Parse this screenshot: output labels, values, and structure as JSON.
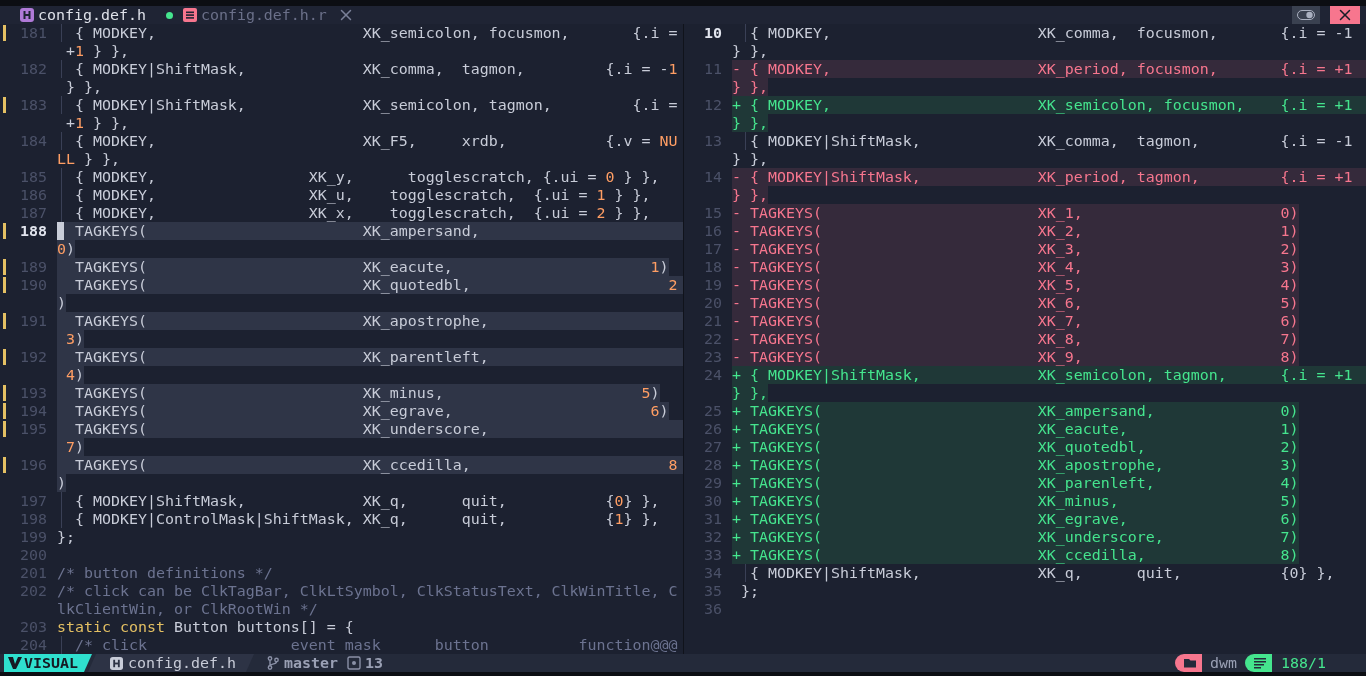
{
  "tabs": [
    {
      "label": "config.def.h",
      "selected": true,
      "modified": true,
      "closable": false
    },
    {
      "label": "config.def.h.r",
      "selected": false,
      "modified": false,
      "closable": true
    }
  ],
  "panes": [
    {
      "kind": "source",
      "lines": [
        {
          "number": "181",
          "changed": true,
          "guide": true,
          "selected": false,
          "current": false,
          "rows": [
            {
              "text": "  { MODKEY,                       XK_semicolon, focusmon,       {.i ="
            },
            {
              "parts": [
                " +",
                {
                  "kind": "number",
                  "text": "1"
                },
                " } },"
              ]
            }
          ]
        },
        {
          "number": "182",
          "changed": false,
          "guide": true,
          "selected": false,
          "current": false,
          "rows": [
            {
              "parts": [
                "  { MODKEY|ShiftMask,             XK_comma,  tagmon,         {.i = -",
                {
                  "kind": "number",
                  "text": "1"
                }
              ]
            },
            {
              "text": " } },"
            }
          ]
        },
        {
          "number": "183",
          "changed": true,
          "guide": true,
          "selected": false,
          "current": false,
          "rows": [
            {
              "text": "  { MODKEY|ShiftMask,             XK_semicolon, tagmon,         {.i ="
            },
            {
              "parts": [
                " +",
                {
                  "kind": "number",
                  "text": "1"
                },
                " } },"
              ]
            }
          ]
        },
        {
          "number": "184",
          "changed": false,
          "guide": true,
          "selected": false,
          "current": false,
          "rows": [
            {
              "parts": [
                "  { MODKEY,                       XK_F5,     xrdb,           {.v = ",
                {
                  "kind": "number",
                  "text": "NU"
                }
              ]
            },
            {
              "parts": [
                {
                  "kind": "number",
                  "text": "LL"
                },
                " } },"
              ]
            }
          ]
        },
        {
          "number": "185",
          "changed": false,
          "guide": true,
          "selected": false,
          "current": false,
          "rows": [
            {
              "parts": [
                "  { MODKEY,                 XK_y,      togglescratch, {.ui = ",
                {
                  "kind": "number",
                  "text": "0"
                },
                " } },"
              ]
            }
          ]
        },
        {
          "number": "186",
          "changed": false,
          "guide": true,
          "selected": false,
          "current": false,
          "rows": [
            {
              "parts": [
                "  { MODKEY,                 XK_u,    togglescratch,  {.ui = ",
                {
                  "kind": "number",
                  "text": "1"
                },
                " } },"
              ]
            }
          ]
        },
        {
          "number": "187",
          "changed": false,
          "guide": true,
          "selected": false,
          "current": false,
          "rows": [
            {
              "parts": [
                "  { MODKEY,                 XK_x,    togglescratch,  {.ui = ",
                {
                  "kind": "number",
                  "text": "2"
                },
                " } },"
              ]
            }
          ]
        },
        {
          "number": "188",
          "changed": true,
          "guide": false,
          "selected": true,
          "current": true,
          "rows": [
            {
              "text": "  TAGKEYS(                        XK_ampersand,"
            },
            {
              "parts": [
                {
                  "kind": "number",
                  "text": "0"
                },
                ")"
              ]
            }
          ]
        },
        {
          "number": "189",
          "changed": true,
          "guide": false,
          "selected": true,
          "current": false,
          "rows": [
            {
              "parts": [
                "  TAGKEYS(                        XK_eacute,                      ",
                {
                  "kind": "number",
                  "text": "1"
                },
                ")"
              ]
            }
          ]
        },
        {
          "number": "190",
          "changed": true,
          "guide": false,
          "selected": true,
          "current": false,
          "rows": [
            {
              "parts": [
                "  TAGKEYS(                        XK_quotedbl,                      ",
                {
                  "kind": "number",
                  "text": "2"
                }
              ]
            },
            {
              "text": ")"
            }
          ]
        },
        {
          "number": "191",
          "changed": true,
          "guide": false,
          "selected": true,
          "current": false,
          "rows": [
            {
              "text": "  TAGKEYS(                        XK_apostrophe,"
            },
            {
              "parts": [
                {
                  "kind": "number",
                  "text": " 3"
                },
                ")"
              ]
            }
          ]
        },
        {
          "number": "192",
          "changed": true,
          "guide": false,
          "selected": true,
          "current": false,
          "rows": [
            {
              "text": "  TAGKEYS(                        XK_parentleft,"
            },
            {
              "parts": [
                {
                  "kind": "number",
                  "text": " 4"
                },
                ")"
              ]
            }
          ]
        },
        {
          "number": "193",
          "changed": true,
          "guide": false,
          "selected": true,
          "current": false,
          "rows": [
            {
              "parts": [
                "  TAGKEYS(                        XK_minus,                      ",
                {
                  "kind": "number",
                  "text": "5"
                },
                ")"
              ]
            }
          ]
        },
        {
          "number": "194",
          "changed": true,
          "guide": false,
          "selected": true,
          "current": false,
          "rows": [
            {
              "parts": [
                "  TAGKEYS(                        XK_egrave,                      ",
                {
                  "kind": "number",
                  "text": "6"
                },
                ")"
              ]
            }
          ]
        },
        {
          "number": "195",
          "changed": true,
          "guide": false,
          "selected": true,
          "current": false,
          "rows": [
            {
              "text": "  TAGKEYS(                        XK_underscore,"
            },
            {
              "parts": [
                {
                  "kind": "number",
                  "text": " 7"
                },
                ")"
              ]
            }
          ]
        },
        {
          "number": "196",
          "changed": true,
          "guide": false,
          "selected": true,
          "current": false,
          "rows": [
            {
              "parts": [
                "  TAGKEYS(                        XK_ccedilla,                      ",
                {
                  "kind": "number",
                  "text": "8"
                }
              ]
            },
            {
              "text": ")"
            }
          ]
        },
        {
          "number": "197",
          "changed": false,
          "guide": true,
          "selected": false,
          "current": false,
          "rows": [
            {
              "parts": [
                "  { MODKEY|ShiftMask,             XK_q,      quit,           {",
                {
                  "kind": "number",
                  "text": "0"
                },
                "} },"
              ]
            }
          ]
        },
        {
          "number": "198",
          "changed": false,
          "guide": true,
          "selected": false,
          "current": false,
          "rows": [
            {
              "parts": [
                "  { MODKEY|ControlMask|ShiftMask, XK_q,      quit,           {",
                {
                  "kind": "number",
                  "text": "1"
                },
                "} },"
              ]
            }
          ]
        },
        {
          "number": "199",
          "changed": false,
          "guide": false,
          "selected": false,
          "current": false,
          "rows": [
            {
              "text": "};"
            }
          ]
        },
        {
          "number": "200",
          "changed": false,
          "guide": false,
          "selected": false,
          "current": false
        },
        {
          "number": "201",
          "changed": false,
          "guide": false,
          "selected": false,
          "current": false,
          "rows": [
            {
              "parts": [
                {
                  "kind": "comment",
                  "text": "/* button definitions */"
                }
              ]
            }
          ]
        },
        {
          "number": "202",
          "changed": false,
          "guide": false,
          "selected": false,
          "current": false,
          "rows": [
            {
              "parts": [
                {
                  "kind": "comment",
                  "text": "/* click can be ClkTagBar, ClkLtSymbol, ClkStatusText, ClkWinTitle, C"
                }
              ]
            },
            {
              "parts": [
                {
                  "kind": "comment",
                  "text": "lkClientWin, or ClkRootWin */"
                }
              ]
            }
          ]
        },
        {
          "number": "203",
          "changed": false,
          "guide": false,
          "selected": false,
          "current": false,
          "rows": [
            {
              "parts": [
                {
                  "kind": "keyword",
                  "text": "static const"
                },
                " Button buttons[] = {"
              ]
            }
          ]
        },
        {
          "number": "204",
          "changed": false,
          "guide": true,
          "selected": false,
          "current": false,
          "rows": [
            {
              "parts": [
                {
                  "kind": "comment",
                  "text": "  /* click                event mask      button          function@@@"
                }
              ]
            }
          ]
        }
      ]
    },
    {
      "kind": "diff",
      "lines": [
        {
          "number": "10",
          "kind": "context",
          "guide": true,
          "current": true,
          "rows": [
            {
              "text": "  { MODKEY,                       XK_comma,  focusmon,       {.i = -1"
            },
            {
              "text": "} },"
            }
          ]
        },
        {
          "number": "11",
          "kind": "removed",
          "guide": false,
          "current": false,
          "rows": [
            {
              "text": "- { MODKEY,                       XK_period, focusmon,       {.i = +1"
            },
            {
              "text": "} },"
            }
          ]
        },
        {
          "number": "12",
          "kind": "added",
          "guide": false,
          "current": false,
          "rows": [
            {
              "text": "+ { MODKEY,                       XK_semicolon, focusmon,    {.i = +1"
            },
            {
              "text": "} },"
            }
          ]
        },
        {
          "number": "13",
          "kind": "context",
          "guide": true,
          "current": false,
          "rows": [
            {
              "text": "  { MODKEY|ShiftMask,             XK_comma,  tagmon,         {.i = -1"
            },
            {
              "text": "} },"
            }
          ]
        },
        {
          "number": "14",
          "kind": "removed",
          "guide": false,
          "current": false,
          "rows": [
            {
              "text": "- { MODKEY|ShiftMask,             XK_period, tagmon,         {.i = +1"
            },
            {
              "text": "} },"
            }
          ]
        },
        {
          "number": "15",
          "kind": "removed",
          "guide": false,
          "current": false,
          "rows": [
            {
              "text": "- TAGKEYS(                        XK_1,                      0)"
            }
          ]
        },
        {
          "number": "16",
          "kind": "removed",
          "guide": false,
          "current": false,
          "rows": [
            {
              "text": "- TAGKEYS(                        XK_2,                      1)"
            }
          ]
        },
        {
          "number": "17",
          "kind": "removed",
          "guide": false,
          "current": false,
          "rows": [
            {
              "text": "- TAGKEYS(                        XK_3,                      2)"
            }
          ]
        },
        {
          "number": "18",
          "kind": "removed",
          "guide": false,
          "current": false,
          "rows": [
            {
              "text": "- TAGKEYS(                        XK_4,                      3)"
            }
          ]
        },
        {
          "number": "19",
          "kind": "removed",
          "guide": false,
          "current": false,
          "rows": [
            {
              "text": "- TAGKEYS(                        XK_5,                      4)"
            }
          ]
        },
        {
          "number": "20",
          "kind": "removed",
          "guide": false,
          "current": false,
          "rows": [
            {
              "text": "- TAGKEYS(                        XK_6,                      5)"
            }
          ]
        },
        {
          "number": "21",
          "kind": "removed",
          "guide": false,
          "current": false,
          "rows": [
            {
              "text": "- TAGKEYS(                        XK_7,                      6)"
            }
          ]
        },
        {
          "number": "22",
          "kind": "removed",
          "guide": false,
          "current": false,
          "rows": [
            {
              "text": "- TAGKEYS(                        XK_8,                      7)"
            }
          ]
        },
        {
          "number": "23",
          "kind": "removed",
          "guide": false,
          "current": false,
          "rows": [
            {
              "text": "- TAGKEYS(                        XK_9,                      8)"
            }
          ]
        },
        {
          "number": "24",
          "kind": "added",
          "guide": false,
          "current": false,
          "rows": [
            {
              "text": "+ { MODKEY|ShiftMask,             XK_semicolon, tagmon,      {.i = +1"
            },
            {
              "text": "} },"
            }
          ]
        },
        {
          "number": "25",
          "kind": "added",
          "guide": false,
          "current": false,
          "rows": [
            {
              "text": "+ TAGKEYS(                        XK_ampersand,              0)"
            }
          ]
        },
        {
          "number": "26",
          "kind": "added",
          "guide": false,
          "current": false,
          "rows": [
            {
              "text": "+ TAGKEYS(                        XK_eacute,                 1)"
            }
          ]
        },
        {
          "number": "27",
          "kind": "added",
          "guide": false,
          "current": false,
          "rows": [
            {
              "text": "+ TAGKEYS(                        XK_quotedbl,               2)"
            }
          ]
        },
        {
          "number": "28",
          "kind": "added",
          "guide": false,
          "current": false,
          "rows": [
            {
              "text": "+ TAGKEYS(                        XK_apostrophe,             3)"
            }
          ]
        },
        {
          "number": "29",
          "kind": "added",
          "guide": false,
          "current": false,
          "rows": [
            {
              "text": "+ TAGKEYS(                        XK_parenleft,              4)"
            }
          ]
        },
        {
          "number": "30",
          "kind": "added",
          "guide": false,
          "current": false,
          "rows": [
            {
              "text": "+ TAGKEYS(                        XK_minus,                  5)"
            }
          ]
        },
        {
          "number": "31",
          "kind": "added",
          "guide": false,
          "current": false,
          "rows": [
            {
              "text": "+ TAGKEYS(                        XK_egrave,                 6)"
            }
          ]
        },
        {
          "number": "32",
          "kind": "added",
          "guide": false,
          "current": false,
          "rows": [
            {
              "text": "+ TAGKEYS(                        XK_underscore,             7)"
            }
          ]
        },
        {
          "number": "33",
          "kind": "added",
          "guide": false,
          "current": false,
          "rows": [
            {
              "text": "+ TAGKEYS(                        XK_ccedilla,               8)"
            }
          ]
        },
        {
          "number": "34",
          "kind": "context",
          "guide": true,
          "current": false,
          "rows": [
            {
              "text": "  { MODKEY|ShiftMask,             XK_q,      quit,           {0} },"
            }
          ]
        },
        {
          "number": "35",
          "kind": "context",
          "guide": false,
          "current": false,
          "rows": [
            {
              "text": " };"
            }
          ]
        },
        {
          "number": "36",
          "kind": "context",
          "guide": false,
          "current": false
        }
      ]
    }
  ],
  "status_bar": {
    "mode": "VISUAL",
    "file": "config.def.h",
    "branch": "master",
    "count": "13",
    "project": "dwm",
    "position": "188/1"
  }
}
